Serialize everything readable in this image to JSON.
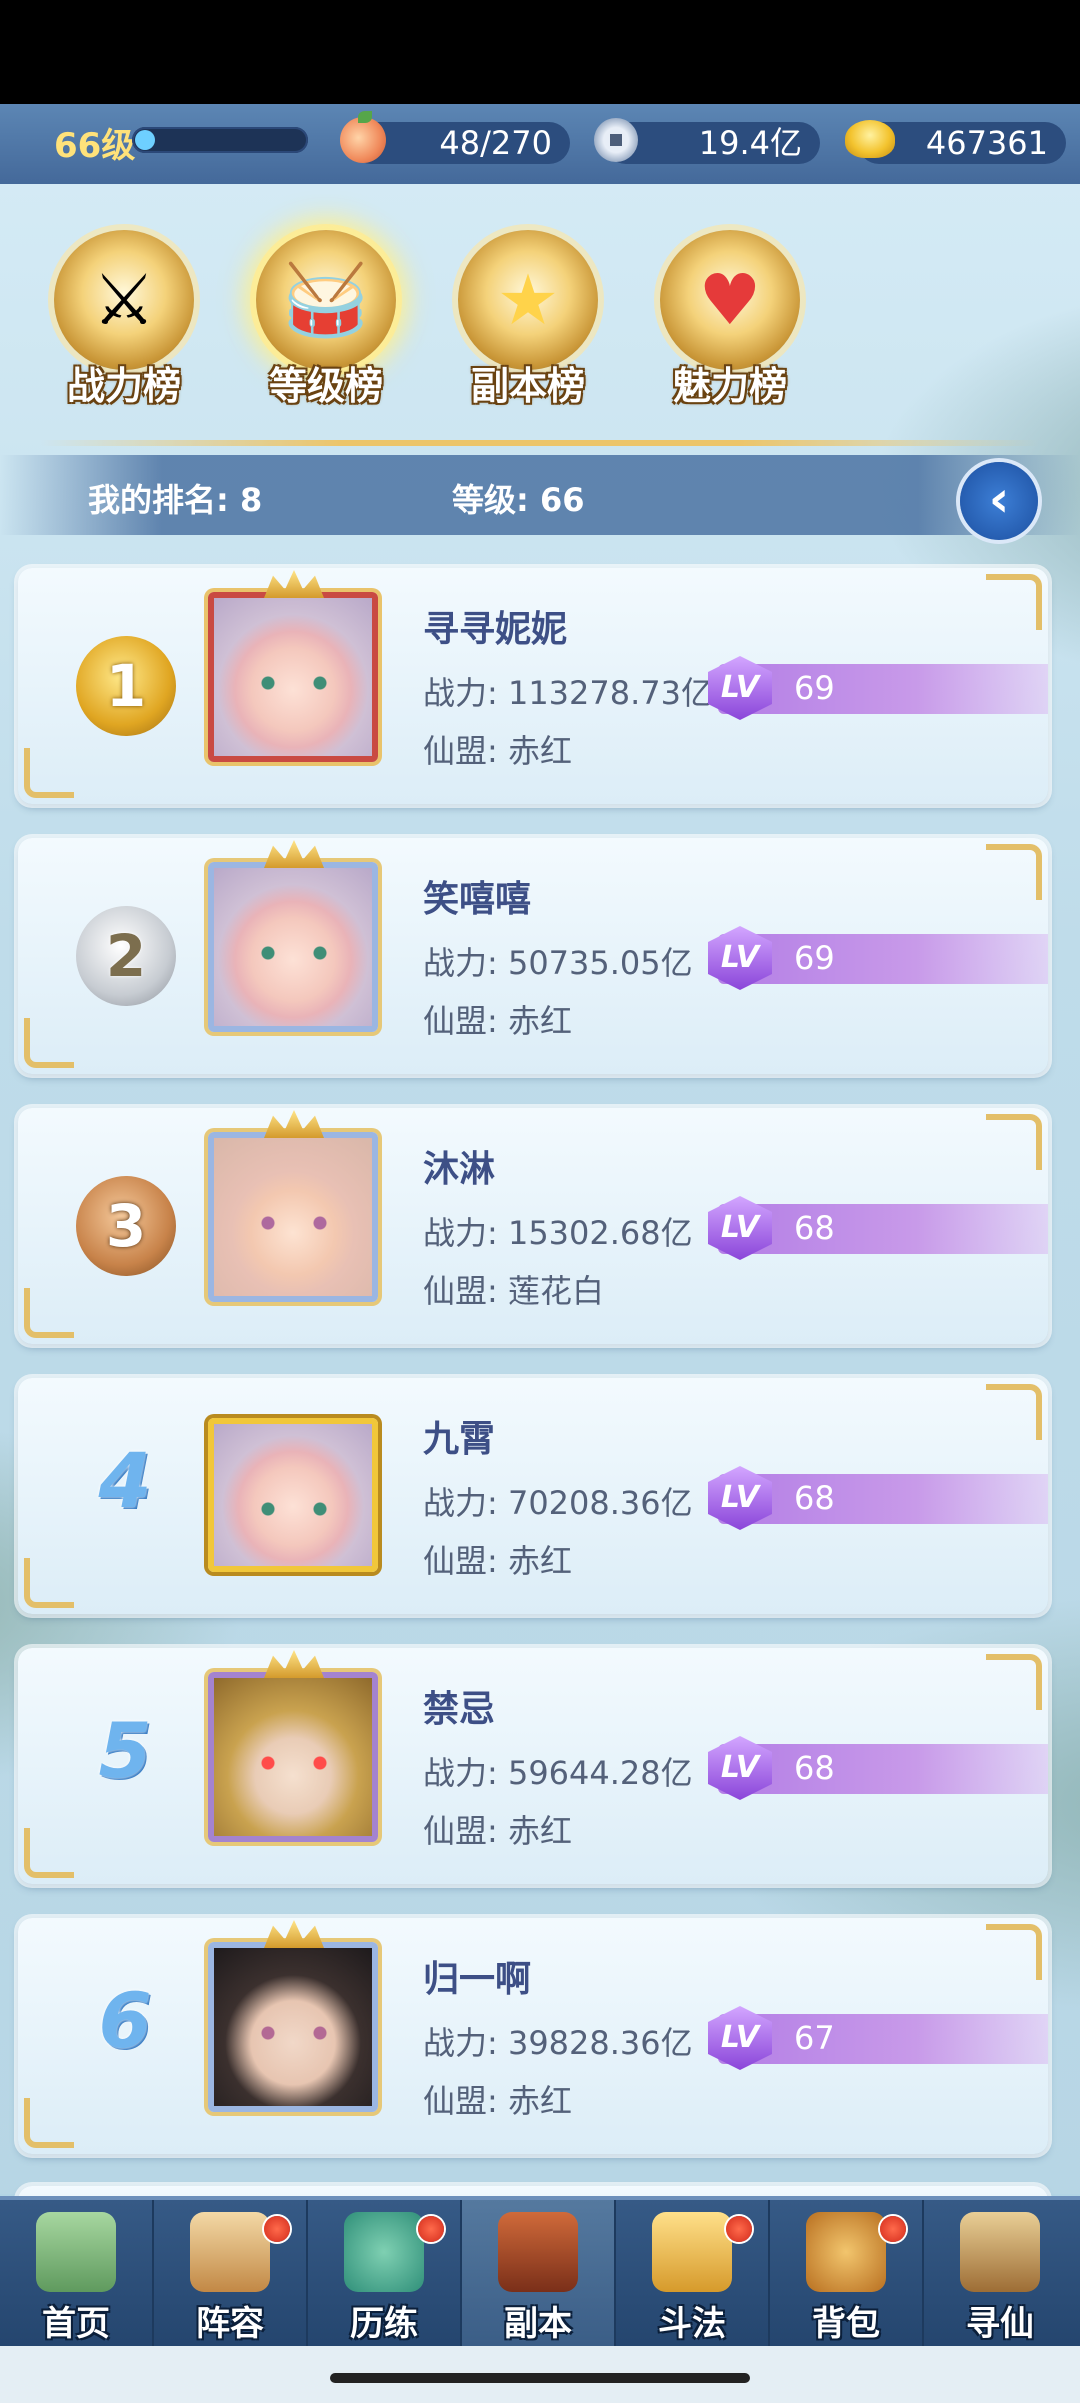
{
  "topbar": {
    "level": "66级",
    "xp_fraction": 0.12,
    "stamina": "48/270",
    "silver": "19.4亿",
    "gold": "467361"
  },
  "tabs": [
    {
      "label": "战力榜",
      "icon": "sword-emblem-icon",
      "active": false
    },
    {
      "label": "等级榜",
      "icon": "drum-emblem-icon",
      "active": true
    },
    {
      "label": "副本榜",
      "icon": "star-emblem-icon",
      "active": false
    },
    {
      "label": "魅力榜",
      "icon": "heart-emblem-icon",
      "active": false
    }
  ],
  "myrank": {
    "rank_text": "我的排名: 8",
    "level_text": "等级: 66"
  },
  "players": [
    {
      "rank": "1",
      "name": "寻寻妮妮",
      "power": "战力: 113278.73亿",
      "guild": "仙盟: 赤红",
      "level": "69"
    },
    {
      "rank": "2",
      "name": "笑嘻嘻",
      "power": "战力: 50735.05亿",
      "guild": "仙盟: 赤红",
      "level": "69"
    },
    {
      "rank": "3",
      "name": "沐淋",
      "power": "战力: 15302.68亿",
      "guild": "仙盟: 莲花白",
      "level": "68"
    },
    {
      "rank": "4",
      "name": "九霄",
      "power": "战力: 70208.36亿",
      "guild": "仙盟: 赤红",
      "level": "68"
    },
    {
      "rank": "5",
      "name": "禁忌",
      "power": "战力: 59644.28亿",
      "guild": "仙盟: 赤红",
      "level": "68"
    },
    {
      "rank": "6",
      "name": "归一啊",
      "power": "战力: 39828.36亿",
      "guild": "仙盟: 赤红",
      "level": "67"
    }
  ],
  "lv_badge": "LV",
  "bottomnav": [
    {
      "label": "首页",
      "badge": false
    },
    {
      "label": "阵容",
      "badge": true
    },
    {
      "label": "历练",
      "badge": true
    },
    {
      "label": "副本",
      "badge": false
    },
    {
      "label": "斗法",
      "badge": true
    },
    {
      "label": "背包",
      "badge": true
    },
    {
      "label": "寻仙",
      "badge": false
    }
  ]
}
